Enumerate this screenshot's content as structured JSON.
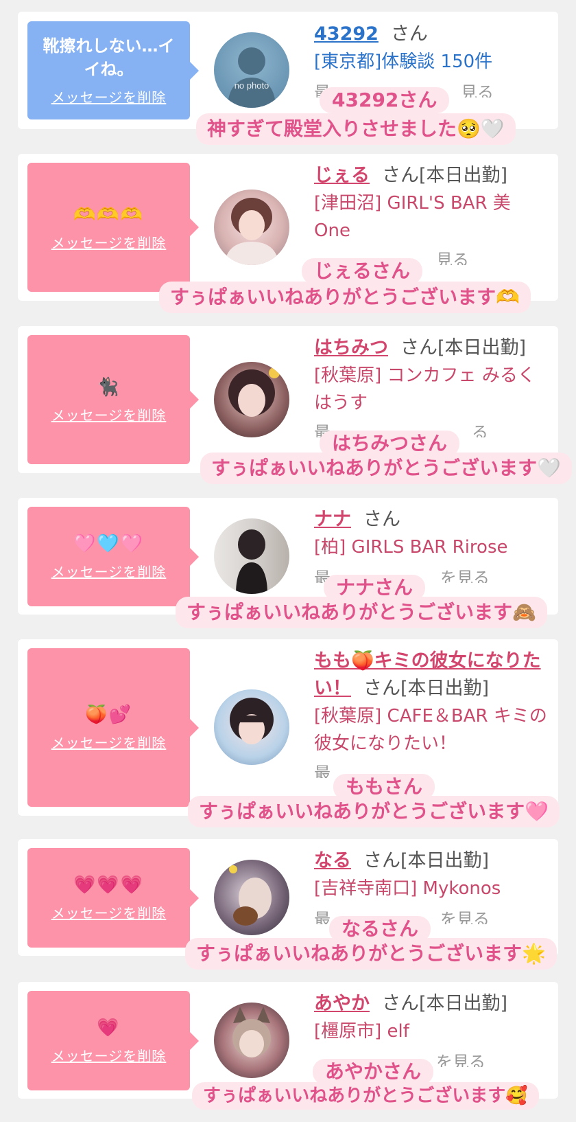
{
  "colors": {
    "pink_bubble": "#fc93a9",
    "blue_bubble": "#86b2f3",
    "name_pink": "#d2466e",
    "name_blue": "#2b72c9",
    "caption_bg": "#fde7ec",
    "caption_text": "#e0528a"
  },
  "items": [
    {
      "message": "靴擦れしない…イイね。",
      "emoji": "",
      "delete_label": "メッセージを削除",
      "name": "43292",
      "san": "さん",
      "shop": "[東京都]体験談 150件",
      "avatar_text": "no photo",
      "more": "最",
      "more_tail": "見る",
      "caption_name": "43292さん",
      "caption_msg": "神すぎて殿堂入りさせました🥺🤍"
    },
    {
      "message": "",
      "emoji": "🫶🫶🫶",
      "delete_label": "メッセージを削除",
      "name": "じぇる",
      "san": "さん[本日出勤]",
      "shop": "[津田沼] GIRL'S BAR 美One",
      "more": "",
      "more_tail": "見る",
      "caption_name": "じぇるさん",
      "caption_msg": "すぅぱぁいいねありがとうございます🫶"
    },
    {
      "message": "",
      "emoji": "🐈‍⬛",
      "delete_label": "メッセージを削除",
      "name": "はちみつ",
      "san": "さん[本日出勤]",
      "shop": "[秋葉原] コンカフェ みるくはうす",
      "more": "最",
      "more_tail": "る",
      "caption_name": "はちみつさん",
      "caption_msg": "すぅぱぁいいねありがとうございます🤍"
    },
    {
      "message": "",
      "emoji": "🩷🩵🩷",
      "delete_label": "メッセージを削除",
      "name": "ナナ",
      "san": "さん",
      "shop": "[柏] GIRLS BAR Rirose",
      "more": "最",
      "more_tail": "を見る",
      "caption_name": "ナナさん",
      "caption_msg": "すぅぱぁいいねありがとうございます🙈"
    },
    {
      "message": "",
      "emoji": "🍑💕",
      "delete_label": "メッセージを削除",
      "name": "もも🍑キミの彼女になりたい！",
      "san": "さん[本日出勤]",
      "shop": "[秋葉原] CAFE＆BAR キミの彼女になりたい！",
      "more": "最",
      "more_tail": "",
      "caption_name": "ももさん",
      "caption_msg": "すぅぱぁいいねありがとうございます🩷"
    },
    {
      "message": "",
      "emoji": "💗💗💗",
      "delete_label": "メッセージを削除",
      "name": "なる",
      "san": "さん[本日出勤]",
      "shop": "[吉祥寺南口] Mykonos",
      "more": "最",
      "more_tail": "を見る",
      "caption_name": "なるさん",
      "caption_msg": "すぅぱぁいいねありがとうございます🌟"
    },
    {
      "message": "",
      "emoji": "💗",
      "delete_label": "メッセージを削除",
      "name": "あやか",
      "san": "さん[本日出勤]",
      "shop": "[橿原市] elf",
      "more": "",
      "more_tail": "を見る",
      "caption_name": "あやかさん",
      "caption_msg": "すぅぱぁいいねありがとうございます🥰"
    }
  ]
}
